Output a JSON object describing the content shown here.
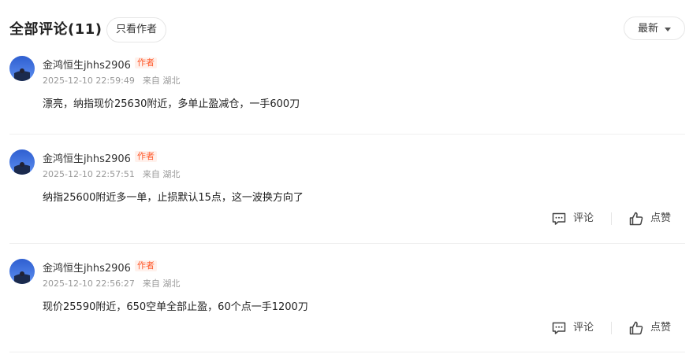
{
  "header": {
    "title": "全部评论(11)",
    "only_author": "只看作者",
    "sort_label": "最新"
  },
  "comments": [
    {
      "user": "金鸿恒生jhhs2906",
      "badge": "作者",
      "time": "2025-12-10 22:59:49",
      "location": "来自 湖北",
      "text": "漂亮，纳指现价25630附近，多单止盈减仓，一手600刀"
    },
    {
      "user": "金鸿恒生jhhs2906",
      "badge": "作者",
      "time": "2025-12-10 22:57:51",
      "location": "来自 湖北",
      "text": "纳指25600附近多一单，止损默认15点，这一波换方向了",
      "actions": {
        "comment": "评论",
        "like": "点赞"
      }
    },
    {
      "user": "金鸿恒生jhhs2906",
      "badge": "作者",
      "time": "2025-12-10 22:56:27",
      "location": "来自 湖北",
      "text": "现价25590附近，650空单全部止盈，60个点一手1200刀",
      "actions": {
        "comment": "评论",
        "like": "点赞"
      }
    }
  ],
  "colors": {
    "badge_text": "#ff5a2c",
    "badge_bg": "#fff1ec",
    "meta": "#999999"
  },
  "icons": [
    "comment-icon",
    "thumbs-up-icon",
    "chevron-down-icon"
  ]
}
